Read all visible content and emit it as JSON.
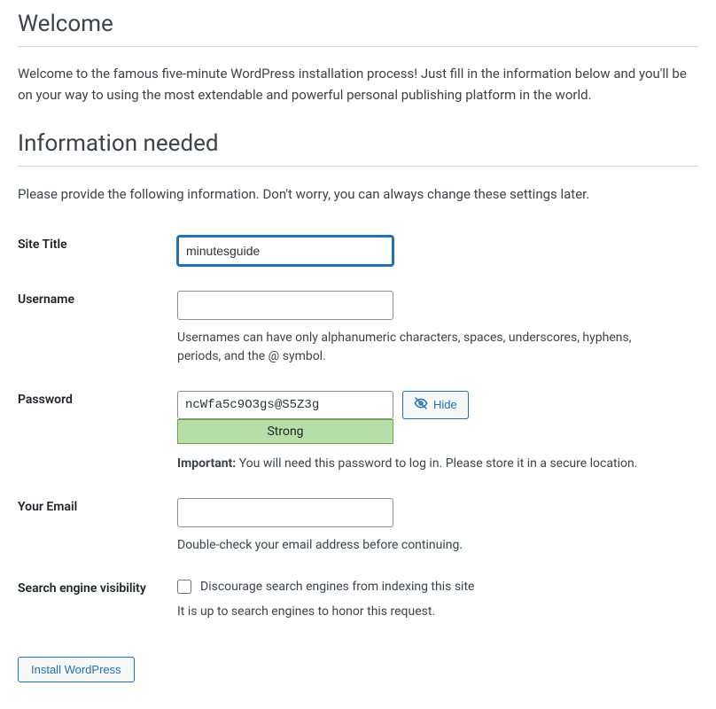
{
  "welcome": {
    "heading": "Welcome",
    "intro": "Welcome to the famous five-minute WordPress installation process! Just fill in the information below and you'll be on your way to using the most extendable and powerful personal publishing platform in the world."
  },
  "info": {
    "heading": "Information needed",
    "intro": "Please provide the following information. Don't worry, you can always change these settings later."
  },
  "fields": {
    "site_title": {
      "label": "Site Title",
      "value": "minutesguide"
    },
    "username": {
      "label": "Username",
      "value": "",
      "desc": "Usernames can have only alphanumeric characters, spaces, underscores, hyphens, periods, and the @ symbol."
    },
    "password": {
      "label": "Password",
      "value": "ncWfa5c9O3gs@S5Z3g",
      "strength": "Strong",
      "hide_label": "Hide",
      "important_label": "Important:",
      "important_text": " You will need this password to log in. Please store it in a secure location."
    },
    "email": {
      "label": "Your Email",
      "value": "",
      "desc": "Double-check your email address before continuing."
    },
    "search_visibility": {
      "label": "Search engine visibility",
      "checkbox_label": "Discourage search engines from indexing this site",
      "desc": "It is up to search engines to honor this request."
    }
  },
  "submit": {
    "label": "Install WordPress"
  }
}
